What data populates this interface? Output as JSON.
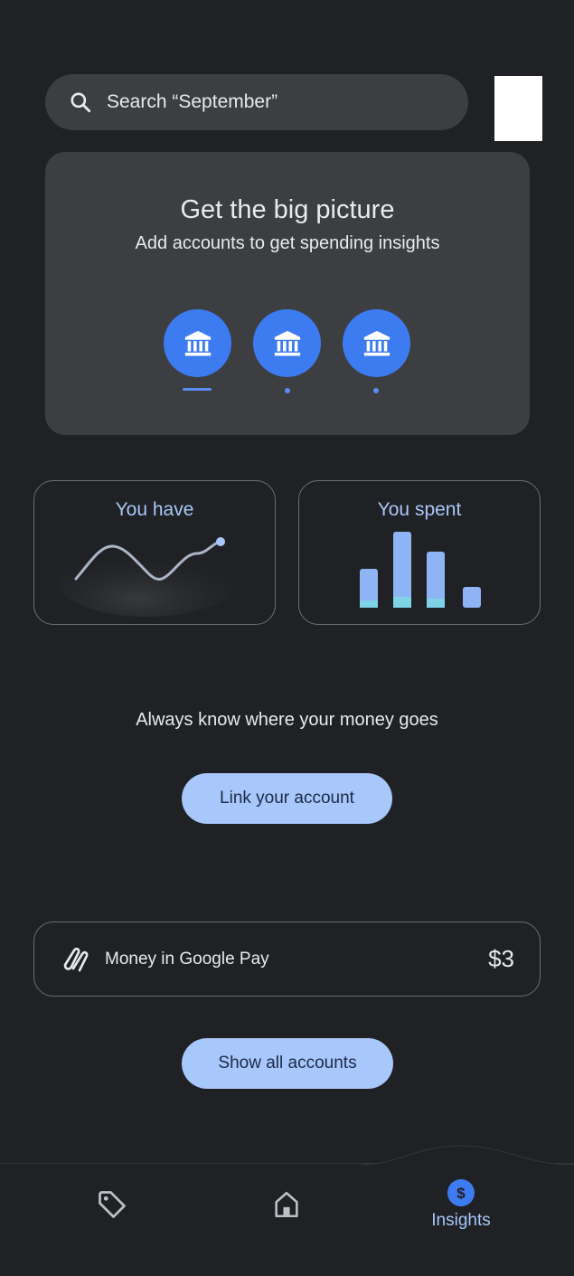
{
  "search": {
    "placeholder": "Search “September”",
    "icon": "search-icon"
  },
  "hero": {
    "title": "Get the big picture",
    "subtitle": "Add accounts to get spending insights",
    "icons": [
      "bank-icon",
      "bank-icon",
      "bank-icon"
    ]
  },
  "cards": {
    "have_label": "You have",
    "spent_label": "You spent"
  },
  "tagline": "Always know where your money goes",
  "link_button": "Link your account",
  "money_row": {
    "label": "Money in Google Pay",
    "amount": "$3",
    "icon": "google-pay-icon"
  },
  "show_button": "Show all accounts",
  "nav": {
    "items": [
      {
        "icon": "tag-icon",
        "label": ""
      },
      {
        "icon": "home-icon",
        "label": ""
      },
      {
        "icon": "dollar-icon",
        "label": "Insights"
      }
    ],
    "active": "Insights"
  },
  "colors": {
    "background": "#202124",
    "card": "#3c3e42",
    "accent": "#a8c7fa",
    "bank_circle": "#3d7bf0"
  }
}
